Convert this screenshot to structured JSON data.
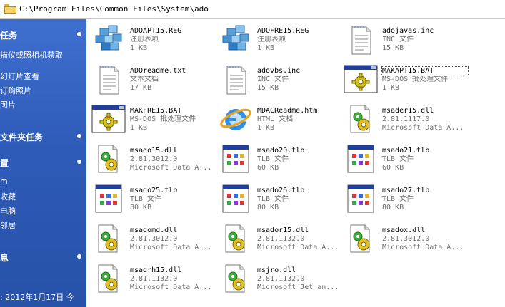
{
  "address": {
    "path": "C:\\Program Files\\Common Files\\System\\ado"
  },
  "task_pane": {
    "sections": [
      {
        "title": "任务",
        "links": [
          "描仪或照相机获取",
          "幻灯片查看",
          "订购照片",
          "图片"
        ]
      },
      {
        "title": "文件夹任务",
        "links": []
      },
      {
        "title": "置",
        "links": [
          "m",
          "收藏",
          "电脑",
          "邻居"
        ]
      },
      {
        "title": "息",
        "links": []
      }
    ],
    "footer": ": 2012年1月17日 今"
  },
  "files": [
    {
      "name": "ADOAPT15.REG",
      "line1": "注册表项",
      "line2": "1 KB",
      "icon": "registry-icon"
    },
    {
      "name": "ADOFRE15.REG",
      "line1": "注册表项",
      "line2": "1 KB",
      "icon": "registry-icon"
    },
    {
      "name": "adojavas.inc",
      "line1": "INC 文件",
      "line2": "15 KB",
      "icon": "document-icon"
    },
    {
      "name": "ADOreadme.txt",
      "line1": "文本文档",
      "line2": "17 KB",
      "icon": "document-icon"
    },
    {
      "name": "adovbs.inc",
      "line1": "INC 文件",
      "line2": "15 KB",
      "icon": "document-icon"
    },
    {
      "name": "MAKAPT15.BAT",
      "line1": "MS-DOS 批处理文件",
      "line2": "1 KB",
      "icon": "batch-file-icon"
    },
    {
      "name": "MAKFRE15.BAT",
      "line1": "MS-DOS 批处理文件",
      "line2": "1 KB",
      "icon": "batch-file-icon"
    },
    {
      "name": "MDACReadme.htm",
      "line1": "HTML 文档",
      "line2": "1 KB",
      "icon": "internet-explorer-icon"
    },
    {
      "name": "msader15.dll",
      "line1": "2.81.1117.0",
      "line2": "Microsoft Data A...",
      "icon": "dll-icon"
    },
    {
      "name": "msado15.dll",
      "line1": "2.81.3012.0",
      "line2": "Microsoft Data A...",
      "icon": "dll-icon"
    },
    {
      "name": "msado20.tlb",
      "line1": "TLB 文件",
      "line2": "60 KB",
      "icon": "tlb-file-icon"
    },
    {
      "name": "msado21.tlb",
      "line1": "TLB 文件",
      "line2": "60 KB",
      "icon": "tlb-file-icon"
    },
    {
      "name": "msado25.tlb",
      "line1": "TLB 文件",
      "line2": "80 KB",
      "icon": "tlb-file-icon"
    },
    {
      "name": "msado26.tlb",
      "line1": "TLB 文件",
      "line2": "80 KB",
      "icon": "tlb-file-icon"
    },
    {
      "name": "msado27.tlb",
      "line1": "TLB 文件",
      "line2": "80 KB",
      "icon": "tlb-file-icon"
    },
    {
      "name": "msadomd.dll",
      "line1": "2.81.3012.0",
      "line2": "Microsoft Data A...",
      "icon": "dll-icon"
    },
    {
      "name": "msador15.dll",
      "line1": "2.81.1132.0",
      "line2": "Microsoft Data A...",
      "icon": "dll-icon"
    },
    {
      "name": "msadox.dll",
      "line1": "2.81.3012.0",
      "line2": "Microsoft Data A...",
      "icon": "dll-icon"
    },
    {
      "name": "msadrh15.dll",
      "line1": "2.81.1132.0",
      "line2": "Microsoft Data A...",
      "icon": "dll-icon"
    },
    {
      "name": "msjro.dll",
      "line1": "2.81.1132.0",
      "line2": "Microsoft Jet an...",
      "icon": "dll-icon"
    }
  ]
}
